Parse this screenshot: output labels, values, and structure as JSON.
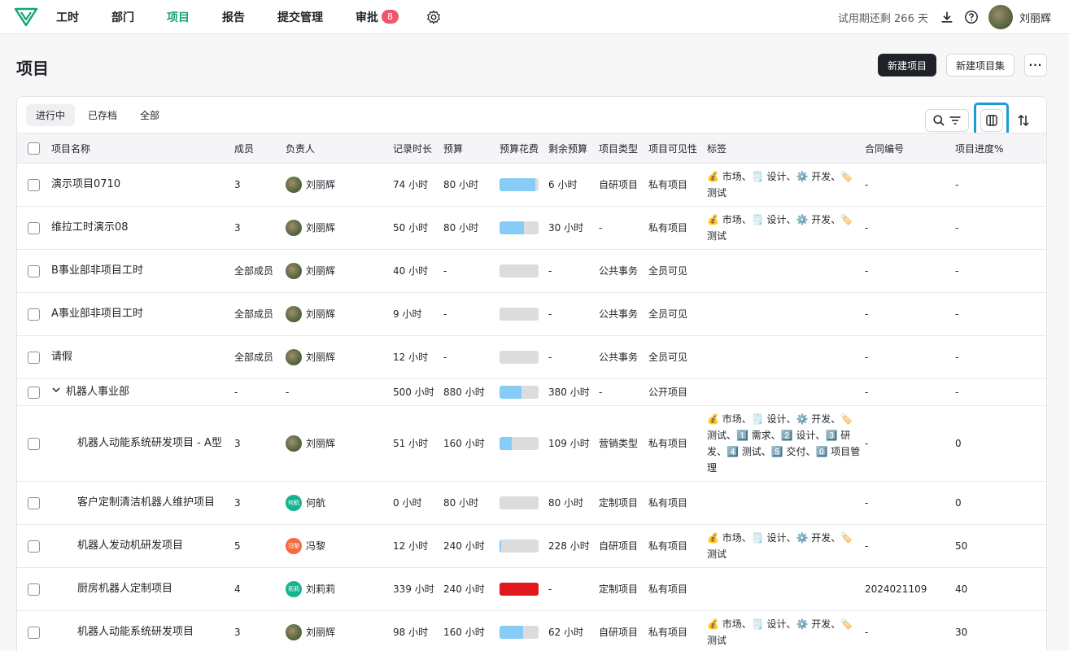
{
  "nav": {
    "items": [
      {
        "label": "工时",
        "active": false
      },
      {
        "label": "部门",
        "active": false
      },
      {
        "label": "项目",
        "active": true
      },
      {
        "label": "报告",
        "active": false
      },
      {
        "label": "提交管理",
        "active": false
      },
      {
        "label": "审批",
        "active": false,
        "badge": "8"
      }
    ],
    "trial_text": "试用期还剩 266 天",
    "user_name": "刘丽辉",
    "icons": [
      "logo-icon",
      "gear-icon",
      "download-icon",
      "help-icon"
    ]
  },
  "header": {
    "title": "项目",
    "new_project": "新建项目",
    "new_project_set": "新建项目集",
    "more": "···"
  },
  "tabs": [
    {
      "label": "进行中",
      "active": true
    },
    {
      "label": "已存档",
      "active": false
    },
    {
      "label": "全部",
      "active": false
    }
  ],
  "columns": [
    "项目名称",
    "成员",
    "负责人",
    "记录时长",
    "预算",
    "预算花费",
    "剩余预算",
    "项目类型",
    "项目可见性",
    "标签",
    "合同编号",
    "项目进度%"
  ],
  "rows": [
    {
      "name": "演示项目0710",
      "members": "3",
      "owner": "刘丽辉",
      "owner_avatar": "photo",
      "logged": "74 小时",
      "budget": "80 小时",
      "spent_pct": 92,
      "remaining": "6 小时",
      "type": "自研项目",
      "visibility": "私有项目",
      "tags": "💰 市场、🗒️ 设计、⚙️ 开发、🏷️ 测试",
      "contract": "-",
      "progress": "-"
    },
    {
      "name": "维拉工时演示08",
      "members": "3",
      "owner": "刘丽辉",
      "owner_avatar": "photo",
      "logged": "50 小时",
      "budget": "80 小时",
      "spent_pct": 62,
      "remaining": "30 小时",
      "type": "-",
      "visibility": "私有项目",
      "tags": "💰 市场、🗒️ 设计、⚙️ 开发、🏷️ 测试",
      "contract": "-",
      "progress": "-"
    },
    {
      "name": "B事业部非项目工时",
      "members": "全部成员",
      "owner": "刘丽辉",
      "owner_avatar": "photo",
      "logged": "40 小时",
      "budget": "-",
      "spent_pct": 0,
      "remaining": "-",
      "type": "公共事务",
      "visibility": "全员可见",
      "tags": "",
      "contract": "-",
      "progress": "-"
    },
    {
      "name": "A事业部非项目工时",
      "members": "全部成员",
      "owner": "刘丽辉",
      "owner_avatar": "photo",
      "logged": "9 小时",
      "budget": "-",
      "spent_pct": 0,
      "remaining": "-",
      "type": "公共事务",
      "visibility": "全员可见",
      "tags": "",
      "contract": "-",
      "progress": "-"
    },
    {
      "name": "请假",
      "members": "全部成员",
      "owner": "刘丽辉",
      "owner_avatar": "photo",
      "logged": "12 小时",
      "budget": "-",
      "spent_pct": 0,
      "remaining": "-",
      "type": "公共事务",
      "visibility": "全员可见",
      "tags": "",
      "contract": "-",
      "progress": "-"
    },
    {
      "name": "机器人事业部",
      "group": true,
      "members": "-",
      "owner": "-",
      "owner_avatar": "",
      "logged": "500 小时",
      "budget": "880 小时",
      "spent_pct": 57,
      "remaining": "380 小时",
      "type": "-",
      "visibility": "公开项目",
      "tags": "",
      "contract": "-",
      "progress": "-"
    },
    {
      "name": "机器人动能系统研发项目 - A型",
      "child": true,
      "members": "3",
      "owner": "刘丽辉",
      "owner_avatar": "photo",
      "logged": "51 小时",
      "budget": "160 小时",
      "spent_pct": 32,
      "remaining": "109 小时",
      "type": "营销类型",
      "visibility": "私有项目",
      "tags": "💰 市场、🗒️ 设计、⚙️ 开发、🏷️ 测试、1️⃣ 需求、2️⃣ 设计、3️⃣ 研发、4️⃣ 测试、5️⃣ 交付、0️⃣ 项目管理",
      "contract": "-",
      "progress": "0"
    },
    {
      "name": "客户定制清洁机器人维护项目",
      "child": true,
      "members": "3",
      "owner": "何航",
      "owner_avatar": "teal",
      "owner_initials": "何航",
      "logged": "0 小时",
      "budget": "80 小时",
      "spent_pct": 0,
      "remaining": "80 小时",
      "type": "定制项目",
      "visibility": "私有项目",
      "tags": "",
      "contract": "-",
      "progress": "0"
    },
    {
      "name": "机器人发动机研发项目",
      "child": true,
      "members": "5",
      "owner": "冯黎",
      "owner_avatar": "orange",
      "owner_initials": "冯黎",
      "logged": "12 小时",
      "budget": "240 小时",
      "spent_pct": 5,
      "remaining": "228 小时",
      "type": "自研项目",
      "visibility": "私有项目",
      "tags": "💰 市场、🗒️ 设计、⚙️ 开发、🏷️ 测试",
      "contract": "-",
      "progress": "50"
    },
    {
      "name": "厨房机器人定制项目",
      "child": true,
      "members": "4",
      "owner": "刘莉莉",
      "owner_avatar": "teal",
      "owner_initials": "莉莉",
      "logged": "339 小时",
      "budget": "240 小时",
      "spent_pct": 100,
      "over": true,
      "remaining": "-",
      "type": "定制项目",
      "visibility": "私有项目",
      "tags": "",
      "contract": "2024021109",
      "progress": "40"
    },
    {
      "name": "机器人动能系统研发项目",
      "child": true,
      "members": "3",
      "owner": "刘丽辉",
      "owner_avatar": "photo",
      "logged": "98 小时",
      "budget": "160 小时",
      "spent_pct": 61,
      "remaining": "62 小时",
      "type": "自研项目",
      "visibility": "私有项目",
      "tags": "💰 市场、🗒️ 设计、⚙️ 开发、🏷️ 测试",
      "contract": "-",
      "progress": "30"
    }
  ],
  "colors": {
    "accent": "#15a37a",
    "highlight": "#1d9bd8",
    "bar_fill": "#86ccf7",
    "bar_over": "#e0181d",
    "badge": "#f0556a"
  }
}
